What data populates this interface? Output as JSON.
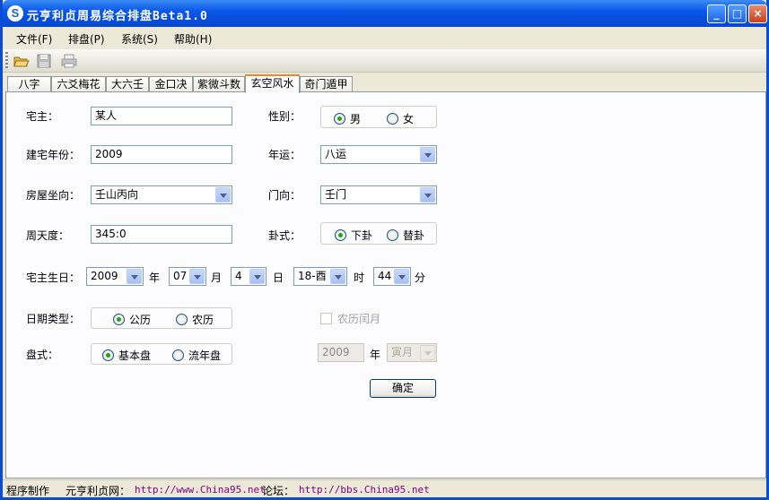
{
  "window": {
    "title": "元亨利贞周易综合排盘Beta1.0",
    "icon": "app-logo-icon"
  },
  "menu": [
    {
      "label": "文件(F)"
    },
    {
      "label": "排盘(P)"
    },
    {
      "label": "系统(S)"
    },
    {
      "label": "帮助(H)"
    }
  ],
  "toolbar": {
    "icons": [
      "open-folder-icon",
      "save-icon",
      "print-icon"
    ]
  },
  "tabs": [
    "八字",
    "六爻梅花",
    "大六壬",
    "金口决",
    "紫微斗数",
    "玄空风水",
    "奇门遁甲"
  ],
  "active_tab": "玄空风水",
  "form": {
    "owner_label": "宅主：",
    "owner_value": "某人",
    "gender_label": "性别：",
    "gender_male": "男",
    "gender_female": "女",
    "build_year_label": "建宅年份：",
    "build_year_value": "2009",
    "period_label": "年运：",
    "period_value": "八运",
    "orientation_label": "房屋坐向：",
    "orientation_value": "壬山丙向",
    "door_label": "门向：",
    "door_value": "壬门",
    "degree_label": "周天度：",
    "degree_value": "345:0",
    "gua_label": "卦式：",
    "gua_option1": "下卦",
    "gua_option2": "替卦",
    "birth_label": "宅主生日：",
    "birth_year": "2009",
    "unit_year": "年",
    "birth_month": "07",
    "unit_month": "月",
    "birth_day": "4",
    "unit_day": "日",
    "birth_hour": "18-酉",
    "unit_hour": "时",
    "birth_minute": "44",
    "unit_minute": "分",
    "date_type_label": "日期类型：",
    "date_solar": "公历",
    "date_lunar": "农历",
    "leap_month": "农历闰月",
    "chart_type_label": "盘式：",
    "chart_basic": "基本盘",
    "chart_yearly": "流年盘",
    "flow_year": "2009",
    "flow_unit_year": "年",
    "flow_month": "寅月",
    "ok_button": "确定"
  },
  "status": {
    "maker": "程序制作",
    "site_label": "元亨利贞网：",
    "site_url": "http://www.China95.net",
    "forum_label": "论坛：",
    "forum_url": "http://bbs.China95.net"
  }
}
